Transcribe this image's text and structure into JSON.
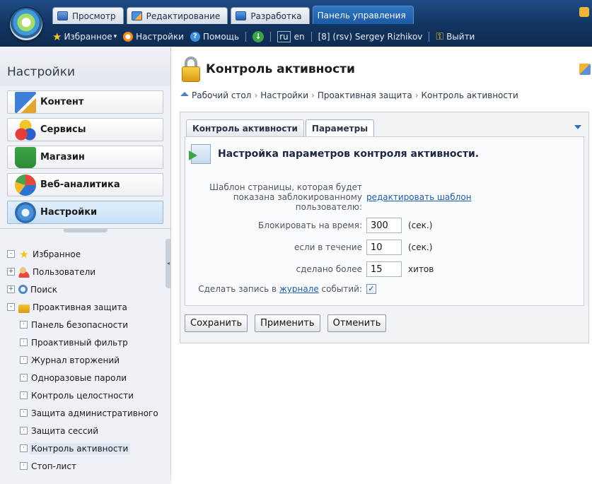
{
  "topbar": {
    "tabs": [
      {
        "label": "Просмотр"
      },
      {
        "label": "Редактирование"
      },
      {
        "label": "Разработка"
      },
      {
        "label": "Панель управления"
      }
    ],
    "favorites": "Избранное",
    "settings": "Настройки",
    "help": "Помощь",
    "lang_ru": "ru",
    "lang_en": "en",
    "user": "[8] (rsv) Sergey Rizhikov",
    "logout": "Выйти"
  },
  "sidebar": {
    "title": "Настройки",
    "menu": [
      {
        "label": "Контент"
      },
      {
        "label": "Сервисы"
      },
      {
        "label": "Магазин"
      },
      {
        "label": "Веб-аналитика"
      },
      {
        "label": "Настройки"
      }
    ],
    "tree": [
      {
        "label": "Избранное",
        "expander": "-"
      },
      {
        "label": "Пользователи",
        "expander": "+"
      },
      {
        "label": "Поиск",
        "expander": "+"
      },
      {
        "label": "Проактивная защита",
        "expander": "-"
      },
      {
        "label": "Панель безопасности"
      },
      {
        "label": "Проактивный фильтр"
      },
      {
        "label": "Журнал вторжений"
      },
      {
        "label": "Одноразовые пароли"
      },
      {
        "label": "Контроль целостности"
      },
      {
        "label": "Защита административного"
      },
      {
        "label": "Защита сессий"
      },
      {
        "label": "Контроль активности"
      },
      {
        "label": "Стоп-лист"
      }
    ]
  },
  "main": {
    "title": "Контроль активности",
    "breadcrumb": [
      "Рабочий стол",
      "Настройки",
      "Проактивная защита",
      "Контроль активности"
    ],
    "tabs": [
      {
        "label": "Контроль активности"
      },
      {
        "label": "Параметры"
      }
    ],
    "section_title": "Настройка параметров контроля активности.",
    "form": {
      "template_label": "Шаблон страницы, которая будет показана заблокированному пользователю:",
      "template_link": "редактировать шаблон",
      "block_label": "Блокировать на время:",
      "block_value": "300",
      "block_unit": "(сек.)",
      "within_label": "если в течение",
      "within_value": "10",
      "within_unit": "(сек.)",
      "hits_label": "сделано более",
      "hits_value": "15",
      "hits_unit": "хитов",
      "log_label_pre": "Сделать запись в",
      "log_link": "журнале",
      "log_label_post": "событий:",
      "log_checked": "✓"
    },
    "buttons": {
      "save": "Сохранить",
      "apply": "Применить",
      "cancel": "Отменить"
    }
  }
}
